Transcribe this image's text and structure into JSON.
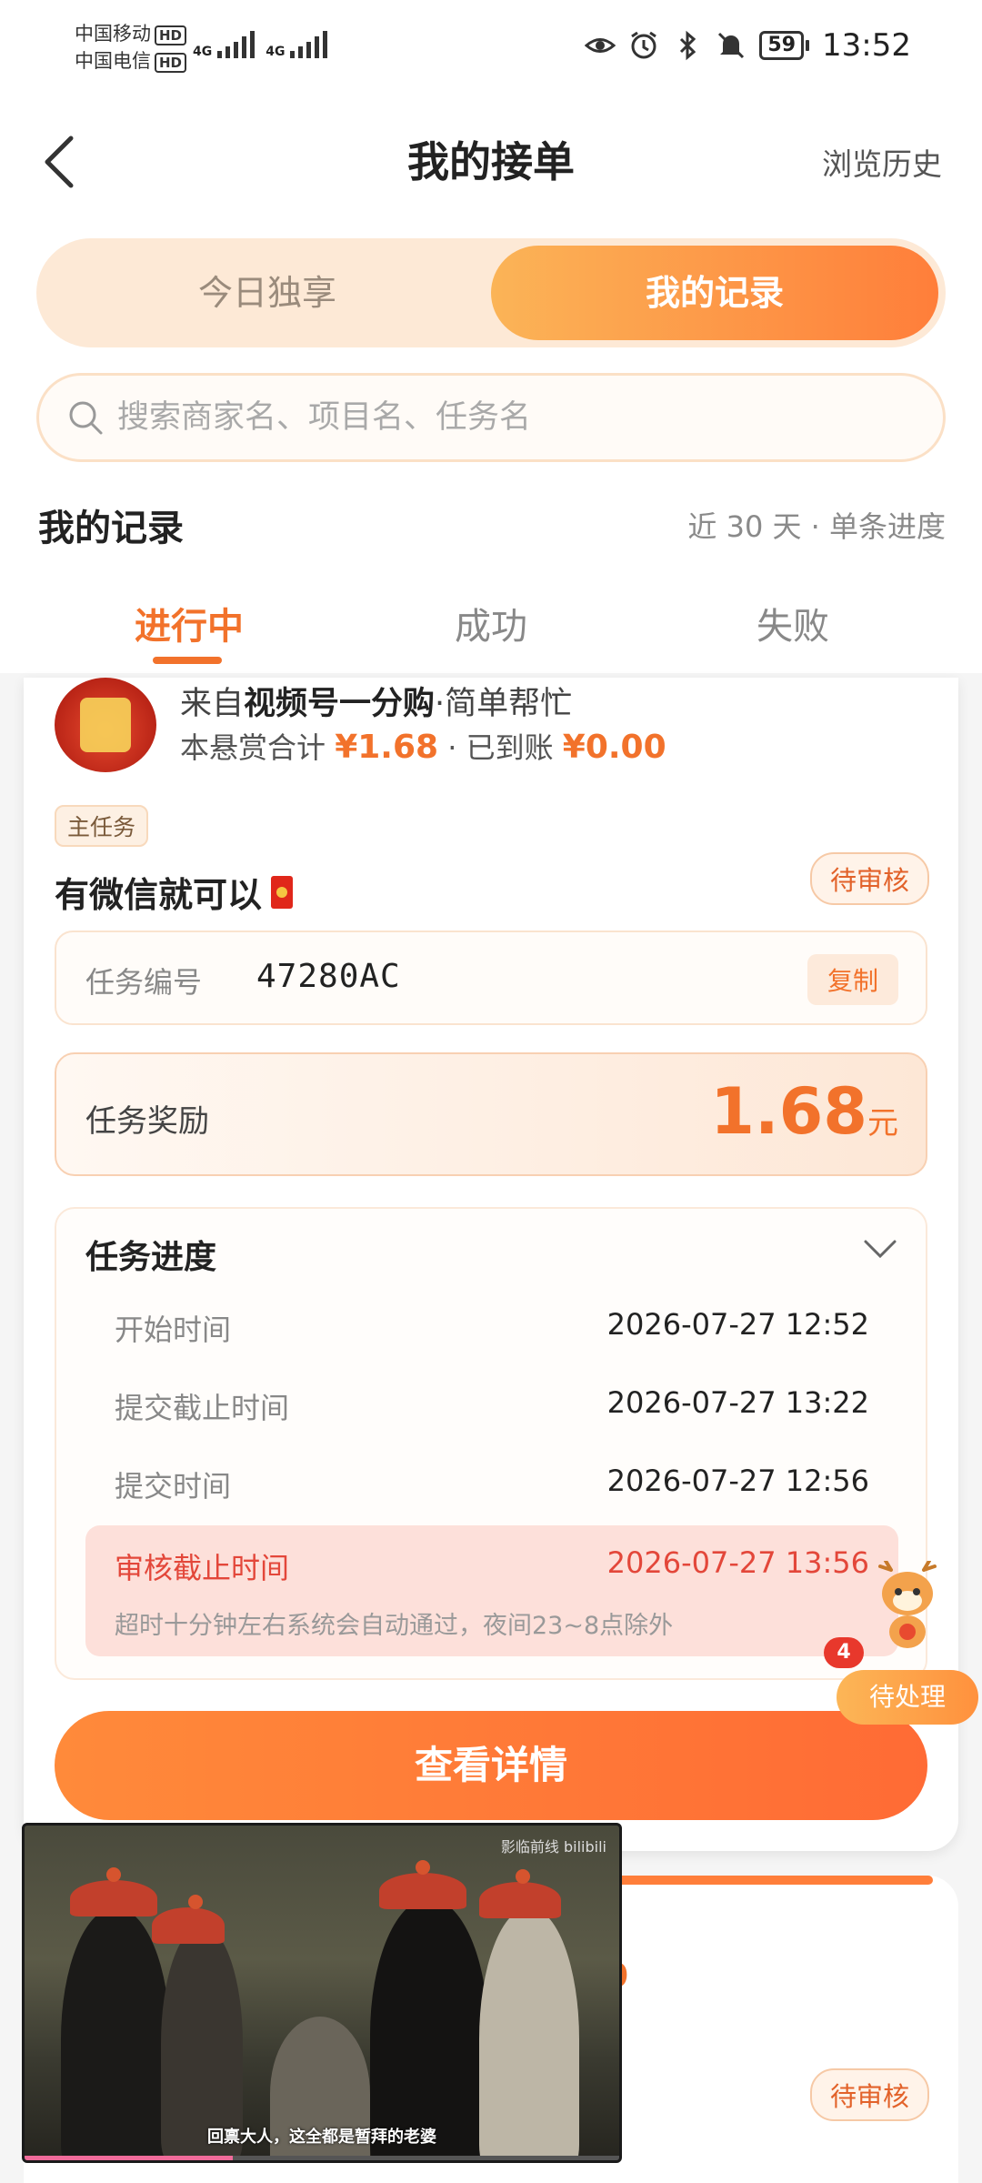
{
  "status_bar": {
    "carrier1": "中国移动",
    "carrier2": "中国电信",
    "hd": "HD",
    "net": "4G",
    "battery": "59",
    "time": "13:52"
  },
  "header": {
    "title": "我的接单",
    "history": "浏览历史"
  },
  "segment": {
    "left": "今日独享",
    "right": "我的记录",
    "selected": "我的记录"
  },
  "search": {
    "placeholder": "搜索商家名、项目名、任务名"
  },
  "records": {
    "title": "我的记录",
    "filter": "近 30 天 · 单条进度"
  },
  "tabs": [
    "进行中",
    "成功",
    "失败"
  ],
  "card": {
    "from_prefix": "来自",
    "merchant": "视频号一分购",
    "project": "·简单帮忙",
    "bounty_label": "本悬赏合计",
    "bounty_total": "¥1.68",
    "arrived_label": "· 已到账",
    "arrived": "¥0.00",
    "main_tag": "主任务",
    "task_name": "有微信就可以",
    "status": "待审核",
    "task_no_label": "任务编号",
    "task_no": "47280AC",
    "copy": "复制",
    "reward_label": "任务奖励",
    "reward": "1.68",
    "reward_unit": "元",
    "progress_title": "任务进度",
    "rows": [
      {
        "k": "开始时间",
        "v": "2026-07-27 12:52"
      },
      {
        "k": "提交截止时间",
        "v": "2026-07-27 13:22"
      },
      {
        "k": "提交时间",
        "v": "2026-07-27 12:56"
      }
    ],
    "audit": {
      "k": "审核截止时间",
      "v": "2026-07-27 13:56",
      "note": "超时十分钟左右系统会自动通过，夜间23~8点除外"
    },
    "detail_button": "查看详情"
  },
  "float": {
    "badge": "4",
    "label": "待处理"
  },
  "card2": {
    "fragment": "0",
    "status": "待审核"
  },
  "pip": {
    "watermark": "影临前线 bilibili",
    "subtitle": "回禀大人，这全都是暂拜的老婆",
    "progress": 0.35
  }
}
